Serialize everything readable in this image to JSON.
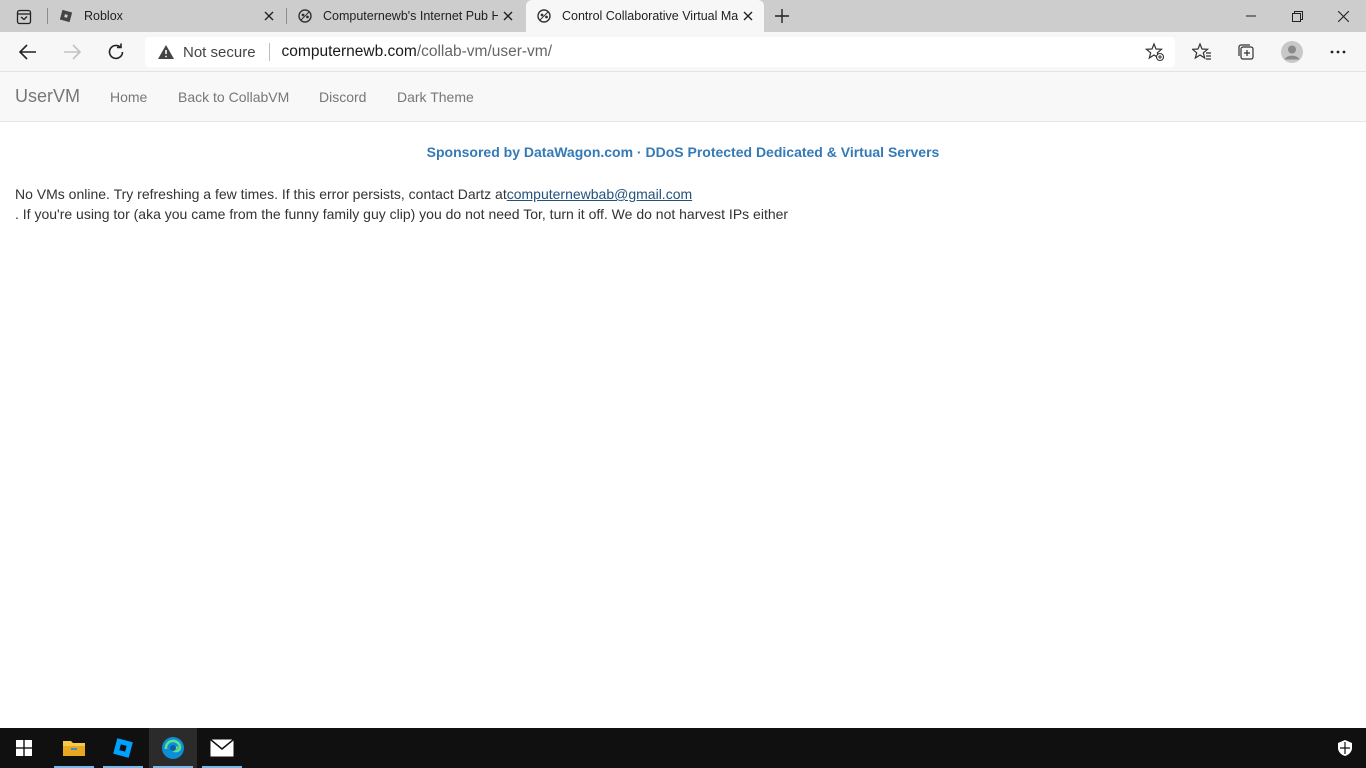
{
  "browser": {
    "tabs": [
      {
        "title": "Roblox",
        "favicon": "roblox-icon",
        "active": false
      },
      {
        "title": "Computernewb's Internet Pub H",
        "favicon": "collabvm-icon",
        "active": false
      },
      {
        "title": "Control Collaborative Virtual Ma",
        "favicon": "collabvm-icon",
        "active": true
      }
    ],
    "security_label": "Not secure",
    "url_host": "computernewb.com",
    "url_path": "/collab-vm/user-vm/"
  },
  "navbar": {
    "brand": "UserVM",
    "links": [
      "Home",
      "Back to CollabVM",
      "Discord",
      "Dark Theme"
    ]
  },
  "content": {
    "sponsor": "Sponsored by DataWagon.com · DDoS Protected Dedicated & Virtual Servers",
    "message_prefix": "No VMs online. Try refreshing a few times. If this error persists, contact Dartz at",
    "email": "computernewbab@gmail.com",
    "message_suffix": ". If you're using tor (aka you came from the funny family guy clip) you do not need Tor, turn it off. We do not harvest IPs either"
  },
  "colors": {
    "sponsor": "#337ab7",
    "taskbar": "#101010",
    "tabstrip": "#cdcdcd"
  }
}
